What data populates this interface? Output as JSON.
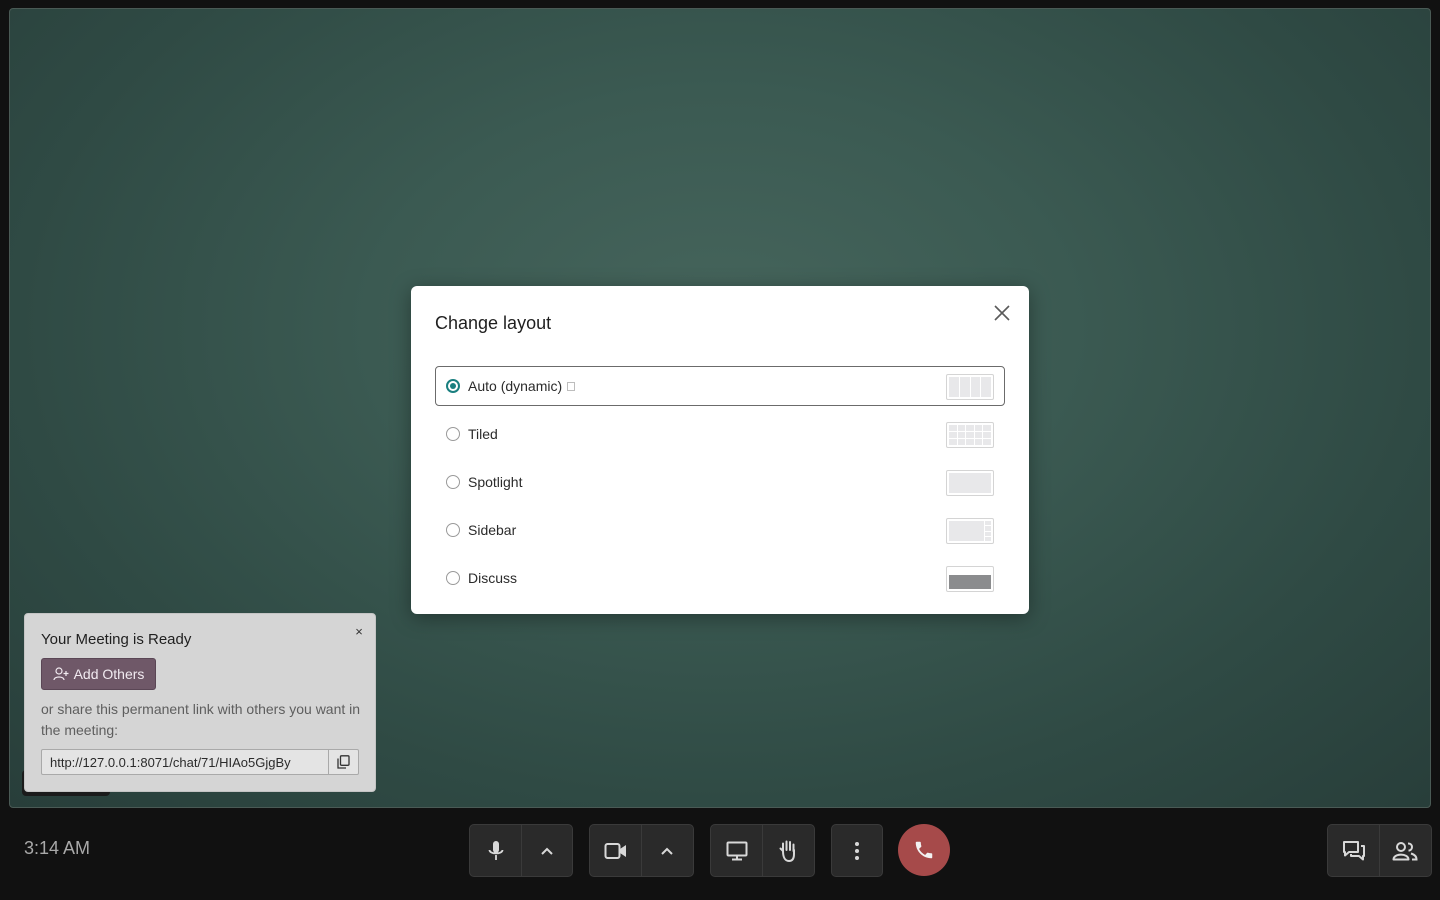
{
  "dialog": {
    "title": "Change layout",
    "close_icon": "close-icon",
    "options": [
      {
        "label": "Auto (dynamic)",
        "selected": true,
        "preview": "auto"
      },
      {
        "label": "Tiled",
        "selected": false,
        "preview": "tiled"
      },
      {
        "label": "Spotlight",
        "selected": false,
        "preview": "spotlight"
      },
      {
        "label": "Sidebar",
        "selected": false,
        "preview": "sidebar"
      },
      {
        "label": "Discuss",
        "selected": false,
        "preview": "discuss"
      }
    ],
    "accent_color": "#1a7f7f"
  },
  "meeting_card": {
    "title": "Your Meeting is Ready",
    "close_label": "×",
    "add_others_label": "Add Others",
    "share_text": "or share this permanent link with others you want in the meeting:",
    "link": "http://127.0.0.1:8071/chat/71/HIAo5GjgBy",
    "button_color": "#6f5868"
  },
  "footer": {
    "time": "3:14 AM",
    "hangup_color": "#a64a4a"
  }
}
